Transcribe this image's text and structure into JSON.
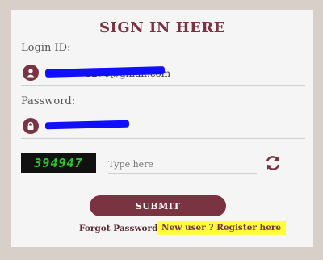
{
  "form": {
    "title": "SIGN IN HERE",
    "login_label": "Login ID:",
    "login_value": "·············1276@gmail.com",
    "password_label": "Password:",
    "password_value": "••••••••••••",
    "captcha_code": "394947",
    "captcha_placeholder": "Type here",
    "submit_label": "SUBMIT",
    "forgot_label": "Forgot Password",
    "register_label": "New user ? Register here"
  },
  "colors": {
    "accent": "#7a3340",
    "background": "#d8cfc9",
    "card": "#f5f5f5",
    "captcha_text": "#29c82a",
    "highlight": "#ffff3c",
    "redaction": "#1010ff"
  }
}
